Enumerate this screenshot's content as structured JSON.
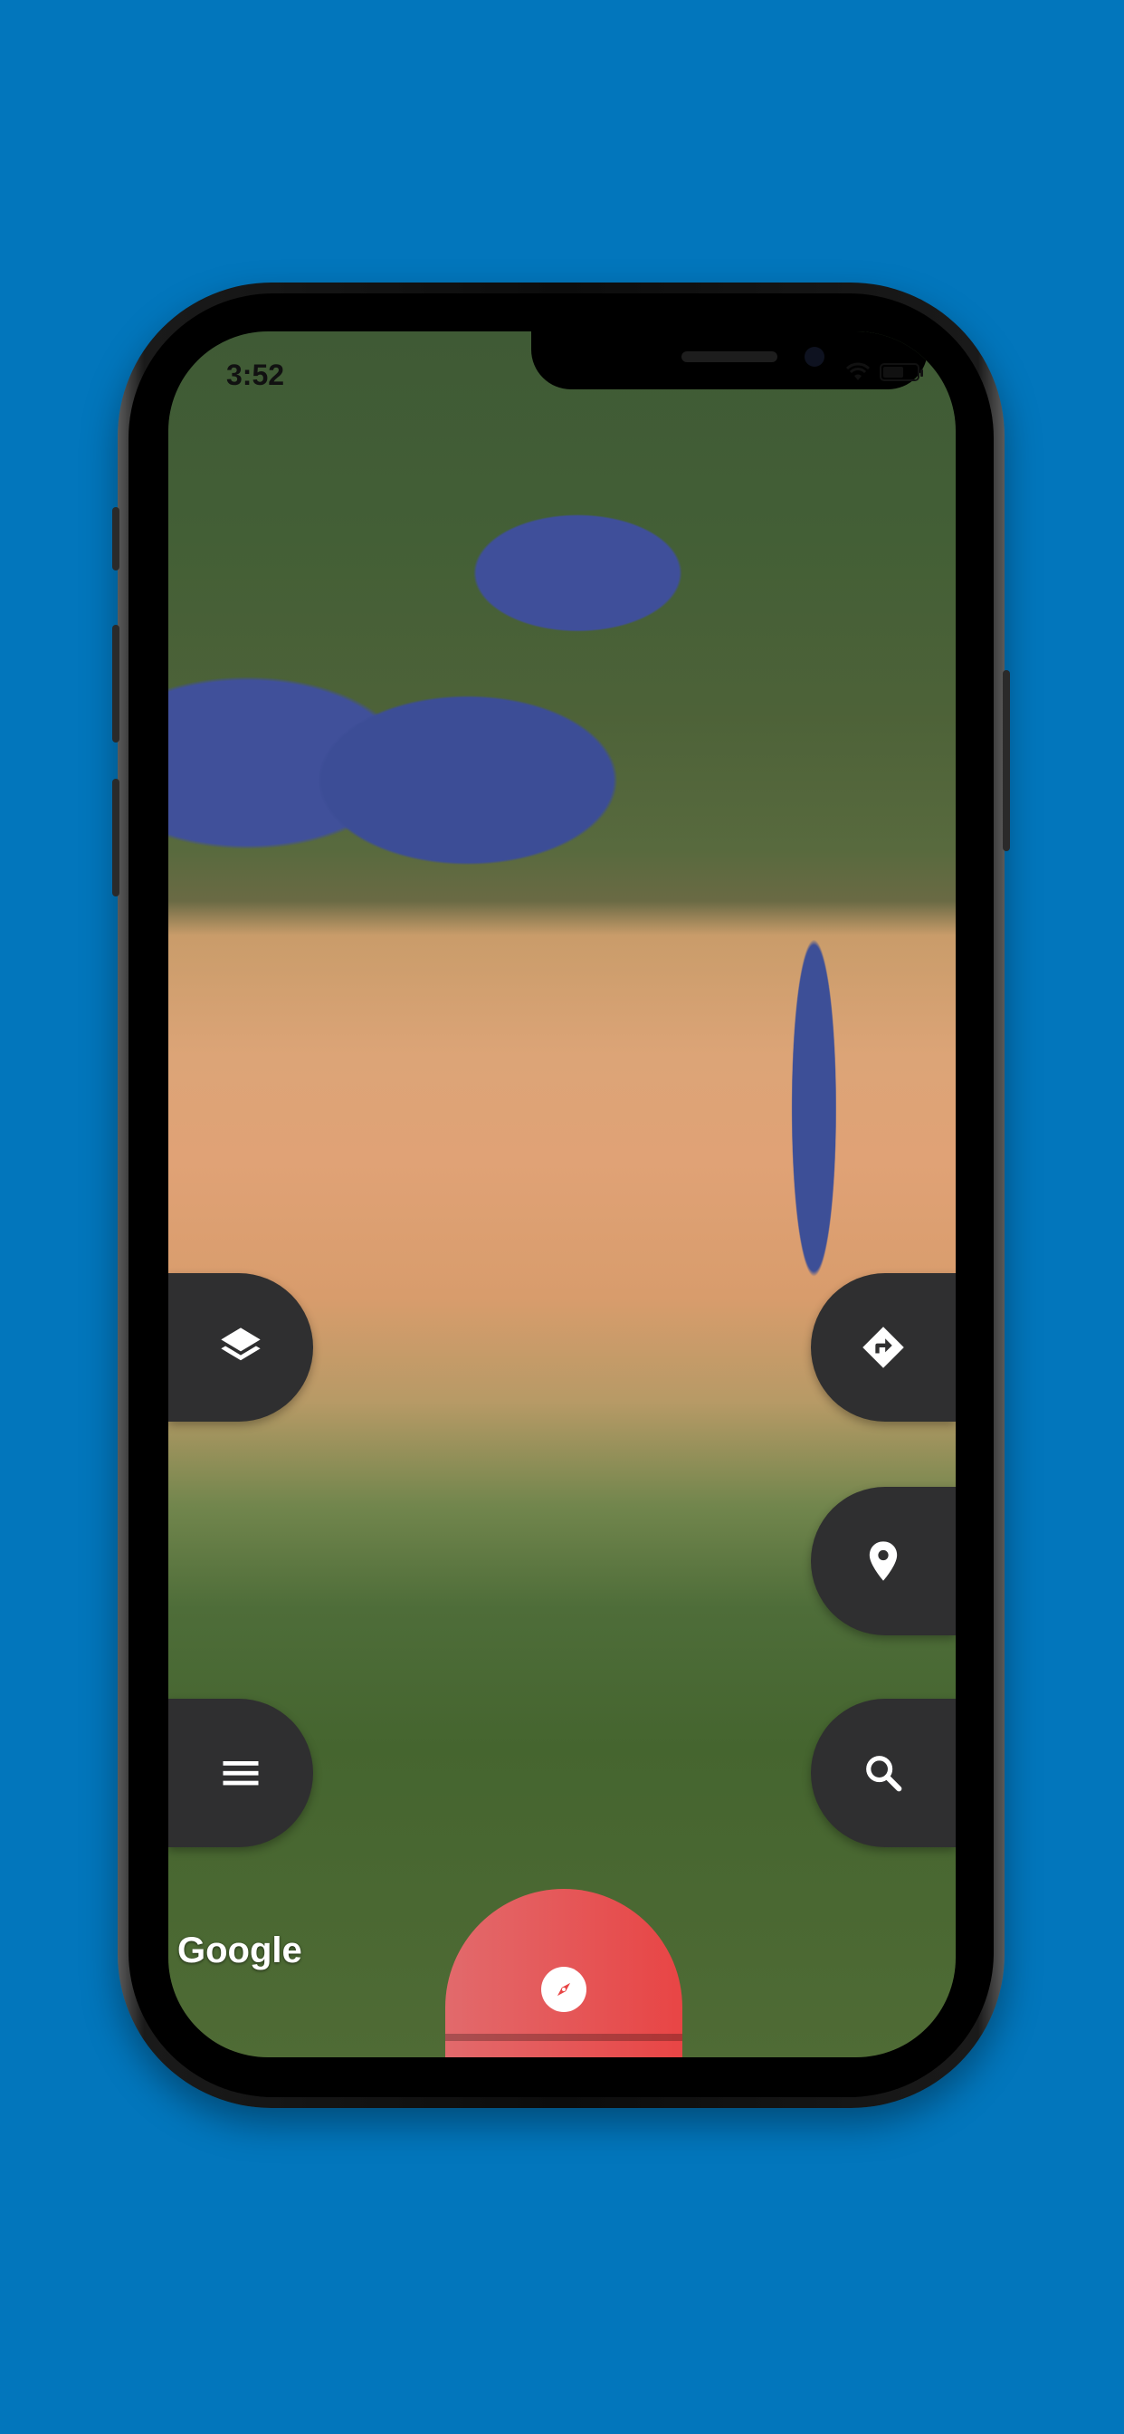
{
  "status_bar": {
    "time": "3:52"
  },
  "map": {
    "attribution": "Google"
  },
  "buttons": {
    "layers": "layers-icon",
    "directions": "directions-icon",
    "location": "location-pin-icon",
    "menu": "menu-icon",
    "search": "search-icon",
    "compass": "compass-icon"
  },
  "colors": {
    "background": "#0276BC",
    "fab": "#2f2f30",
    "compass_button": "#e84545"
  }
}
